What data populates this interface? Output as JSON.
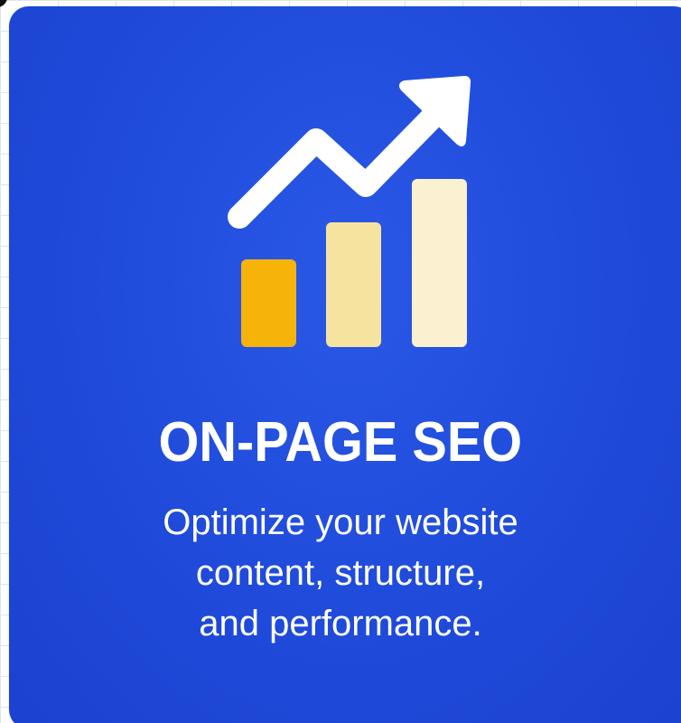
{
  "card": {
    "title": "ON-PAGE SEO",
    "subtitle_lines": [
      "Optimize your website",
      "content, structure,",
      "and performance."
    ]
  },
  "icon": {
    "name": "growth-chart-icon",
    "bars": [
      {
        "name": "bar-short",
        "color": "#f6b30a",
        "relative_height": 0.52
      },
      {
        "name": "bar-medium",
        "color": "#f7e3a0",
        "relative_height": 0.74
      },
      {
        "name": "bar-tall",
        "color": "#fbf0cf",
        "relative_height": 1.0
      }
    ],
    "arrow_color": "#ffffff"
  },
  "colors": {
    "card_background": "#1f4ada",
    "text": "#ffffff"
  }
}
